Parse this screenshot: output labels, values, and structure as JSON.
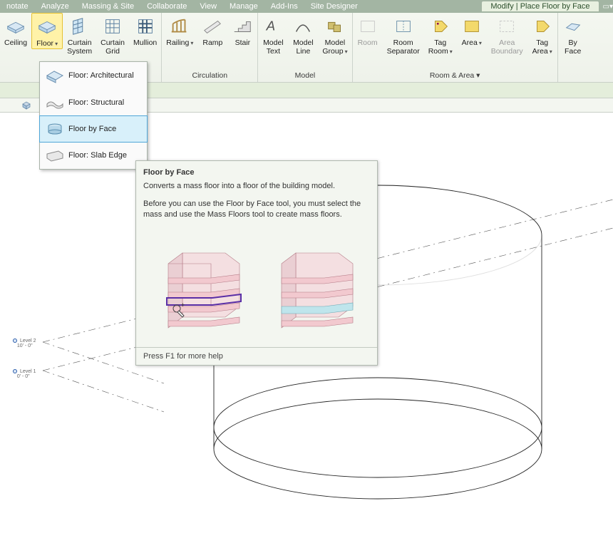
{
  "menubar": {
    "items": [
      "notate",
      "Analyze",
      "Massing & Site",
      "Collaborate",
      "View",
      "Manage",
      "Add-Ins",
      "Site Designer"
    ],
    "title_tab": "Modify | Place Floor by Face",
    "sm_glyph": "▭▾"
  },
  "ribbon": {
    "panel_build": {
      "ceiling": "Ceiling",
      "floor": "Floor",
      "curtain_system": "Curtain\nSystem",
      "curtain_grid": "Curtain\nGrid",
      "mullion": "Mullion"
    },
    "panel_circ": {
      "railing": "Railing",
      "ramp": "Ramp",
      "stair": "Stair",
      "caption": "Circulation"
    },
    "panel_model": {
      "model_text": "Model\nText",
      "model_line": "Model\nLine",
      "model_group": "Model\nGroup",
      "caption": "Model"
    },
    "panel_room": {
      "room": "Room",
      "room_sep": "Room\nSeparator",
      "tag_room": "Tag\nRoom",
      "area": "Area",
      "area_boundary": "Area\nBoundary",
      "tag_area": "Tag\nArea",
      "caption": "Room & Area ▾"
    },
    "panel_face": {
      "by_face": "By\nFace"
    }
  },
  "dropdown": {
    "items": [
      {
        "label": "Floor: Architectural"
      },
      {
        "label": "Floor: Structural"
      },
      {
        "label": "Floor by Face"
      },
      {
        "label": "Floor: Slab Edge"
      }
    ]
  },
  "tooltip": {
    "title": "Floor by Face",
    "line1": "Converts a mass floor into a floor of the building model.",
    "line2": "Before you can use the Floor by Face tool, you must select the mass and use the Mass Floors tool to create mass floors.",
    "footer": "Press F1 for more help"
  },
  "levels": {
    "l2": {
      "name": "Level 2",
      "elev": "10' - 0\""
    },
    "l1": {
      "name": "Level 1",
      "elev": "0' - 0\""
    }
  }
}
